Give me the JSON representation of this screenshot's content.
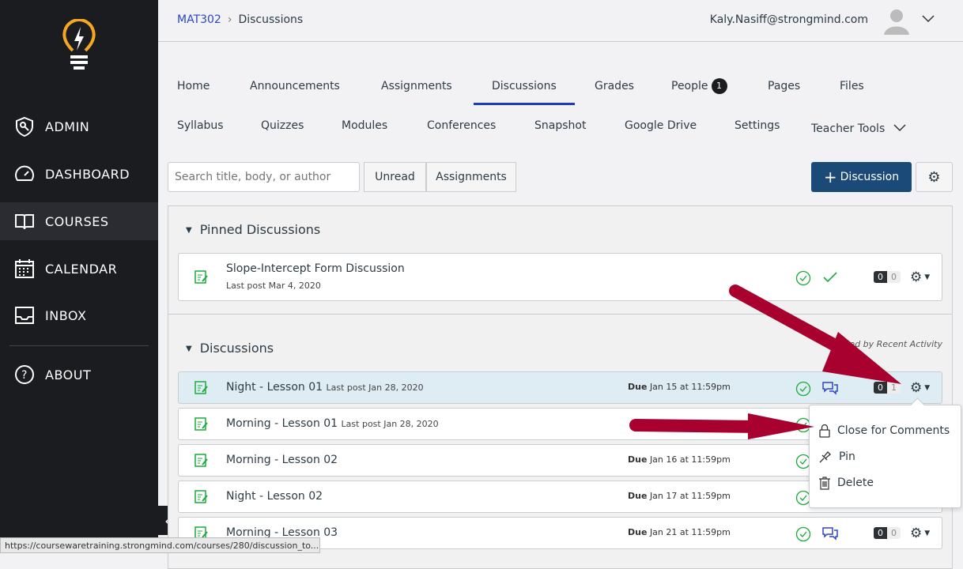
{
  "sidebar": {
    "items": [
      {
        "label": "ADMIN",
        "icon": "shield-key-icon"
      },
      {
        "label": "DASHBOARD",
        "icon": "speedometer-icon"
      },
      {
        "label": "COURSES",
        "icon": "book-icon",
        "active": true
      },
      {
        "label": "CALENDAR",
        "icon": "calendar-icon"
      },
      {
        "label": "INBOX",
        "icon": "inbox-icon"
      },
      {
        "label": "ABOUT",
        "icon": "question-icon"
      }
    ]
  },
  "header": {
    "breadcrumb": {
      "course": "MAT302",
      "current": "Discussions"
    },
    "user": "Kaly.Nasiff@strongmind.com"
  },
  "tabs": {
    "row1": [
      "Home",
      "Announcements",
      "Assignments",
      "Discussions",
      "Grades",
      "People",
      "Pages",
      "Files"
    ],
    "people_badge": "1",
    "row2": [
      "Syllabus",
      "Quizzes",
      "Modules",
      "Conferences",
      "Snapshot",
      "Google Drive",
      "Settings",
      "Teacher Tools"
    ],
    "active": "Discussions"
  },
  "toolbar": {
    "search_placeholder": "Search title, body, or author",
    "unread": "Unread",
    "assignments": "Assignments",
    "add": "Discussion"
  },
  "pinned": {
    "title": "Pinned Discussions",
    "rows": [
      {
        "title": "Slope-Intercept Form Discussion",
        "last_post": "Last post Mar 4, 2020",
        "unread": "0",
        "total": "0"
      }
    ]
  },
  "discussions": {
    "title": "Discussions",
    "order": "Ordered by Recent Activity",
    "due_label": "Due",
    "rows": [
      {
        "title": "Night - Lesson 01",
        "last_post": "Last post Jan 28, 2020",
        "due": "Jan 15 at 11:59pm",
        "unread": "0",
        "total": "1"
      },
      {
        "title": "Morning - Lesson 01",
        "last_post": "Last post Jan 28, 2020",
        "due": "",
        "unread": "",
        "total": ""
      },
      {
        "title": "Morning - Lesson 02",
        "last_post": "",
        "due": "Jan 16 at 11:59pm",
        "unread": "",
        "total": ""
      },
      {
        "title": "Night - Lesson 02",
        "last_post": "",
        "due": "Jan 17 at 11:59pm",
        "unread": "",
        "total": ""
      },
      {
        "title": "Morning - Lesson 03",
        "last_post": "",
        "due": "Jan 21 at 11:59pm",
        "unread": "0",
        "total": "0"
      }
    ]
  },
  "menu": {
    "items": [
      "Close for Comments",
      "Pin",
      "Delete"
    ]
  },
  "status_bar": "https://coursewaretraining.strongmind.com/courses/280/discussion_to...",
  "colors": {
    "sidebar": "#1b1c20",
    "accent": "#1b4a78",
    "link": "#2b45c8",
    "success": "#1aac3b",
    "arrow": "#a8002f"
  }
}
